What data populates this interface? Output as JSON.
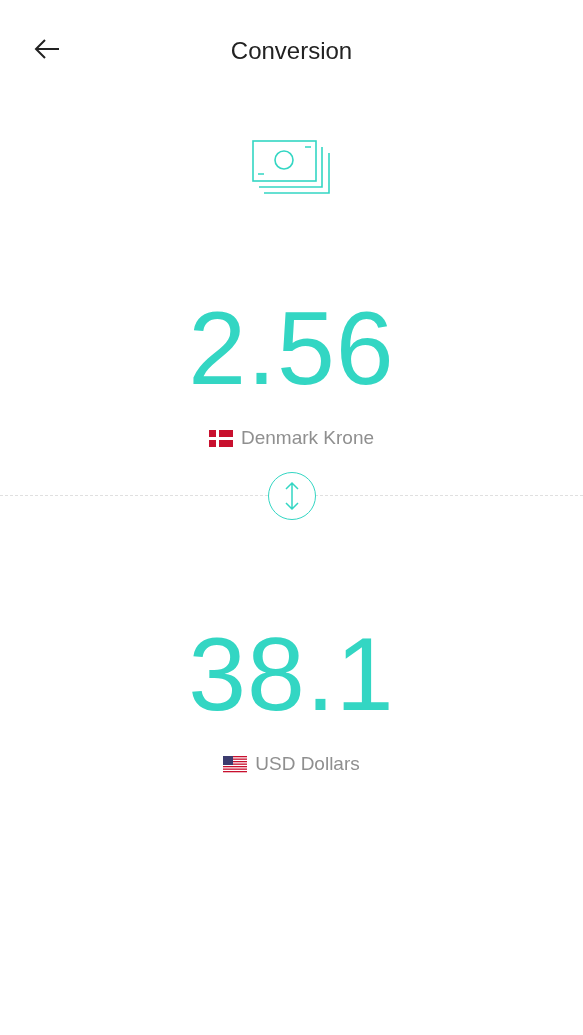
{
  "header": {
    "title": "Conversion"
  },
  "currencies": [
    {
      "amount": "2.56",
      "name": "Denmark Krone"
    },
    {
      "amount": "38.1",
      "name": "USD Dollars"
    }
  ]
}
